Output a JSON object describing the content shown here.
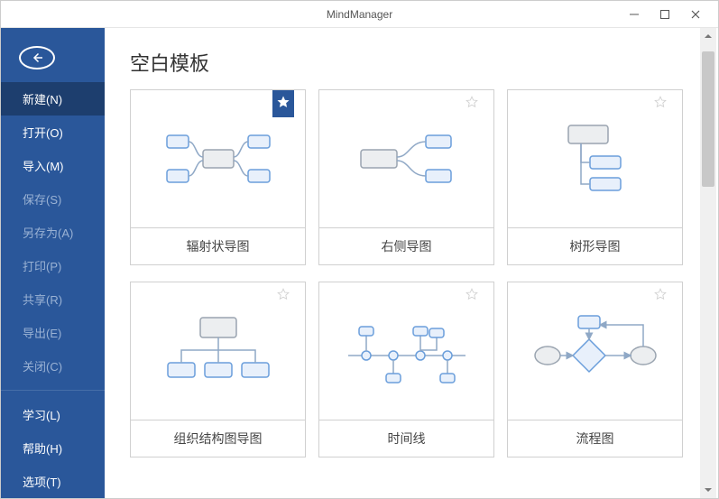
{
  "app": {
    "title": "MindManager"
  },
  "sidebar": {
    "items": [
      {
        "label": "新建(N)",
        "active": true,
        "dim": false
      },
      {
        "label": "打开(O)",
        "active": false,
        "dim": false
      },
      {
        "label": "导入(M)",
        "active": false,
        "dim": false
      },
      {
        "label": "保存(S)",
        "active": false,
        "dim": true
      },
      {
        "label": "另存为(A)",
        "active": false,
        "dim": true
      },
      {
        "label": "打印(P)",
        "active": false,
        "dim": true
      },
      {
        "label": "共享(R)",
        "active": false,
        "dim": true
      },
      {
        "label": "导出(E)",
        "active": false,
        "dim": true
      },
      {
        "label": "关闭(C)",
        "active": false,
        "dim": true
      }
    ],
    "items2": [
      {
        "label": "学习(L)"
      },
      {
        "label": "帮助(H)"
      },
      {
        "label": "选项(T)"
      }
    ]
  },
  "content": {
    "section_title": "空白模板",
    "templates": [
      {
        "label": "辐射状导图",
        "favorite": true,
        "diagram": "radial"
      },
      {
        "label": "右侧导图",
        "favorite": false,
        "diagram": "right"
      },
      {
        "label": "树形导图",
        "favorite": false,
        "diagram": "tree"
      },
      {
        "label": "组织结构图导图",
        "favorite": false,
        "diagram": "org"
      },
      {
        "label": "时间线",
        "favorite": false,
        "diagram": "timeline"
      },
      {
        "label": "流程图",
        "favorite": false,
        "diagram": "flow"
      }
    ]
  },
  "icons": {
    "back": "back-arrow-icon",
    "minimize": "minimize-icon",
    "maximize": "maximize-icon",
    "close": "close-icon",
    "star": "star-icon"
  }
}
